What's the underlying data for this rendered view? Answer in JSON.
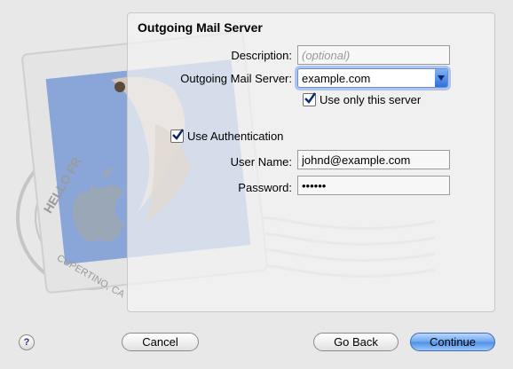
{
  "panel": {
    "title": "Outgoing Mail Server"
  },
  "form": {
    "description_label": "Description:",
    "description_placeholder": "(optional)",
    "server_label": "Outgoing Mail Server:",
    "server_value": "example.com",
    "use_only_label": "Use only this server",
    "use_only_checked": true,
    "use_auth_label": "Use Authentication",
    "use_auth_checked": true,
    "username_label": "User Name:",
    "username_value": "johnd@example.com",
    "password_label": "Password:",
    "password_value": "••••••"
  },
  "stamp": {
    "top_text": "HELLO FR",
    "bottom_text": "CUPERTINO, CA"
  },
  "buttons": {
    "help": "?",
    "cancel": "Cancel",
    "go_back": "Go Back",
    "continue": "Continue"
  },
  "colors": {
    "accent": "#4d8ee6",
    "stamp_blue": "#8aa6d8"
  }
}
